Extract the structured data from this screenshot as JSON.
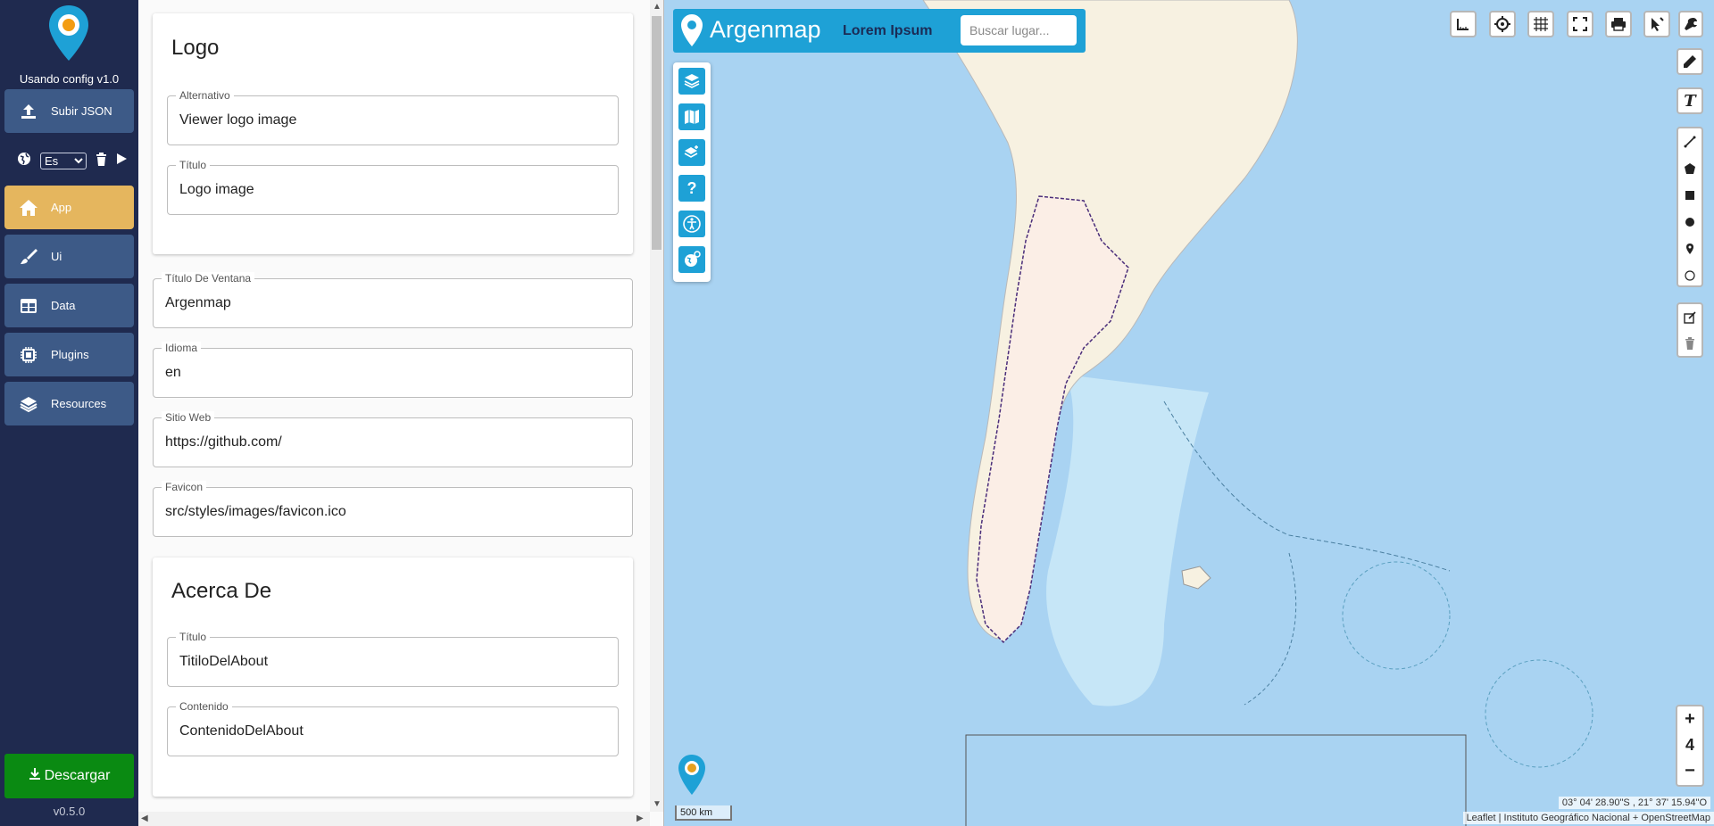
{
  "sidebar": {
    "config_label": "Usando config v1.0",
    "upload_label": "Subir JSON",
    "language_value": "Es",
    "items": [
      {
        "label": "App",
        "icon": "home-icon",
        "active": true
      },
      {
        "label": "Ui",
        "icon": "brush-icon",
        "active": false
      },
      {
        "label": "Data",
        "icon": "table-icon",
        "active": false
      },
      {
        "label": "Plugins",
        "icon": "chip-icon",
        "active": false
      },
      {
        "label": "Resources",
        "icon": "layers-icon",
        "active": false
      }
    ],
    "download_label": "Descargar",
    "version": "v0.5.0",
    "colors": {
      "bg": "#1f2a4f",
      "button": "#3d5a87",
      "active": "#e5b65e",
      "download": "#0a8a12"
    }
  },
  "form": {
    "logo_card": {
      "title": "Logo",
      "alt_label": "Alternativo",
      "alt_value": "Viewer logo image",
      "title_label": "Título",
      "title_value": "Logo image"
    },
    "window_title_label": "Título De Ventana",
    "window_title_value": "Argenmap",
    "language_label": "Idioma",
    "language_value": "en",
    "website_label": "Sitio Web",
    "website_value": "https://github.com/",
    "favicon_label": "Favicon",
    "favicon_value": "src/styles/images/favicon.ico",
    "about_card": {
      "title": "Acerca De",
      "title_label": "Título",
      "title_value": "TitiloDelAbout",
      "content_label": "Contenido",
      "content_value": "ContenidoDelAbout"
    }
  },
  "map": {
    "brand": "Argenmap",
    "subtitle": "Lorem Ipsum",
    "search_placeholder": "Buscar lugar...",
    "zoom_level": "4",
    "zoom_in": "+",
    "zoom_out": "−",
    "scale": "500 km",
    "coordinates": "03° 04' 28.90\"S , 21° 37' 15.94\"O",
    "attribution": "Leaflet | Instituto Geográfico Nacional + OpenStreetMap",
    "accent": "#1ea1d6"
  }
}
